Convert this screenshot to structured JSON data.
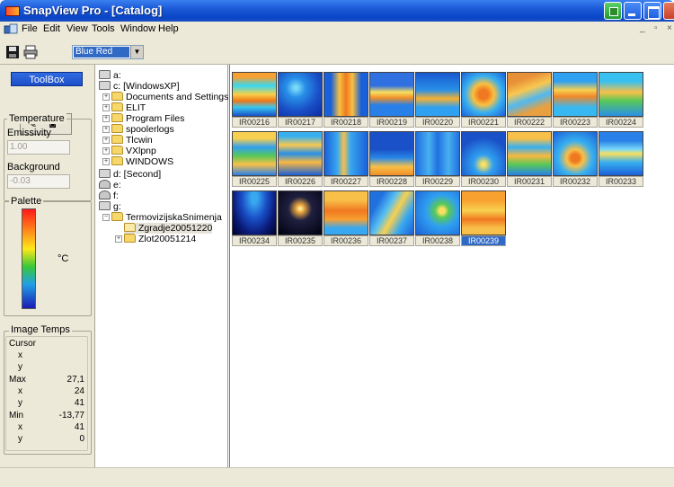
{
  "window": {
    "title": "SnapView Pro - [Catalog]"
  },
  "menu": [
    "File",
    "Edit",
    "View",
    "Tools",
    "Window",
    "Help"
  ],
  "mdi_controls": {
    "minimize": "_",
    "restore": "▫",
    "close": "×"
  },
  "toolbar": {
    "palette_value": "Blue Red"
  },
  "toolbox": {
    "header": "ToolBox",
    "temperature_label": "Temperature",
    "emissivity_label": "Emissivity",
    "emissivity_value": "1.00",
    "background_label": "Background",
    "background_value": "-0.03",
    "palette_label": "Palette",
    "unit": "°C",
    "image_temps_label": "Image Temps",
    "cursor_label": "Cursor",
    "x_label": "x",
    "y_label": "y",
    "max_label": "Max",
    "max_value": "27,1",
    "max_x": "24",
    "max_y": "41",
    "min_label": "Min",
    "min_value": "-13,77",
    "min_x": "41",
    "min_y": "0"
  },
  "tree": [
    {
      "label": "a:",
      "icon": "drive"
    },
    {
      "label": "c: [WindowsXP]",
      "icon": "drive"
    },
    {
      "label": "Documents and Settings",
      "icon": "folder"
    },
    {
      "label": "ELIT",
      "icon": "folder"
    },
    {
      "label": "Program Files",
      "icon": "folder"
    },
    {
      "label": "spoolerlogs",
      "icon": "folder"
    },
    {
      "label": "Tlcwin",
      "icon": "folder"
    },
    {
      "label": "VXlpnp",
      "icon": "folder"
    },
    {
      "label": "WINDOWS",
      "icon": "folder"
    },
    {
      "label": "d: [Second]",
      "icon": "drive"
    },
    {
      "label": "e:",
      "icon": "network-drive"
    },
    {
      "label": "f:",
      "icon": "network-drive"
    },
    {
      "label": "g:",
      "icon": "drive"
    },
    {
      "label": "TermovizijskaSnimenja",
      "icon": "folder"
    },
    {
      "label": "Zgradje20051220",
      "icon": "folder-open"
    },
    {
      "label": "Zlot20051214",
      "icon": "folder"
    }
  ],
  "thumbnails": [
    {
      "label": "IR00216"
    },
    {
      "label": "IR00217"
    },
    {
      "label": "IR00218"
    },
    {
      "label": "IR00219"
    },
    {
      "label": "IR00220"
    },
    {
      "label": "IR00221"
    },
    {
      "label": "IR00222"
    },
    {
      "label": "IR00223"
    },
    {
      "label": "IR00224"
    },
    {
      "label": "IR00225"
    },
    {
      "label": "IR00226"
    },
    {
      "label": "IR00227"
    },
    {
      "label": "IR00228"
    },
    {
      "label": "IR00229"
    },
    {
      "label": "IR00230"
    },
    {
      "label": "IR00231"
    },
    {
      "label": "IR00232"
    },
    {
      "label": "IR00233"
    },
    {
      "label": "IR00234"
    },
    {
      "label": "IR00235"
    },
    {
      "label": "IR00236"
    },
    {
      "label": "IR00237"
    },
    {
      "label": "IR00238"
    },
    {
      "label": "IR00239"
    }
  ],
  "colors": {
    "title_bar": "#1c5ad8",
    "selection": "#316ac5",
    "panel": "#ece9d8"
  }
}
